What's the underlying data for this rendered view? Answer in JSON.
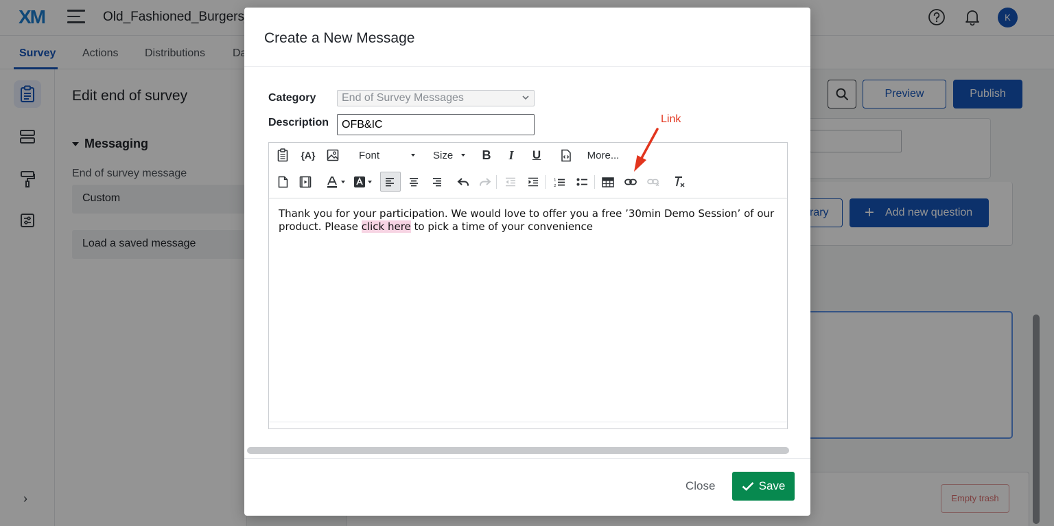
{
  "app": {
    "logo": "XM",
    "project_title": "Old_Fashioned_Burgers_",
    "avatar_initial": "K"
  },
  "nav": {
    "tabs": [
      "Survey",
      "Actions",
      "Distributions",
      "Da"
    ],
    "active_tab": "Survey"
  },
  "edit_panel": {
    "title": "Edit end of survey",
    "section": "Messaging",
    "field_label": "End of survey message",
    "selected_option": "Custom",
    "load_button": "Load a saved message"
  },
  "canvas": {
    "preview_label": "Preview",
    "publish_label": "Publish",
    "library_label": "rary",
    "add_question_label": "Add new question",
    "empty_trash_label": "Empty trash"
  },
  "modal": {
    "title": "Create a New Message",
    "category_label": "Category",
    "category_value": "End of Survey Messages",
    "description_label": "Description",
    "description_value": "OFB&IC",
    "toolbar": {
      "font_label": "Font",
      "size_label": "Size",
      "more_label": "More...",
      "piped_text_label": "{A}"
    },
    "body": {
      "text_before": "Thank you for your participation. We would love to offer you a free ’30min Demo Session’ of our product. Please ",
      "link_text": "click here",
      "text_after": " to pick a time of your convenience"
    },
    "close_label": "Close",
    "save_label": "Save"
  },
  "annotation": {
    "label": "Link",
    "color": "#e2351e"
  },
  "colors": {
    "brand_blue": "#1655b8",
    "save_green": "#07894f",
    "logo_blue": "#1b7ccf"
  }
}
